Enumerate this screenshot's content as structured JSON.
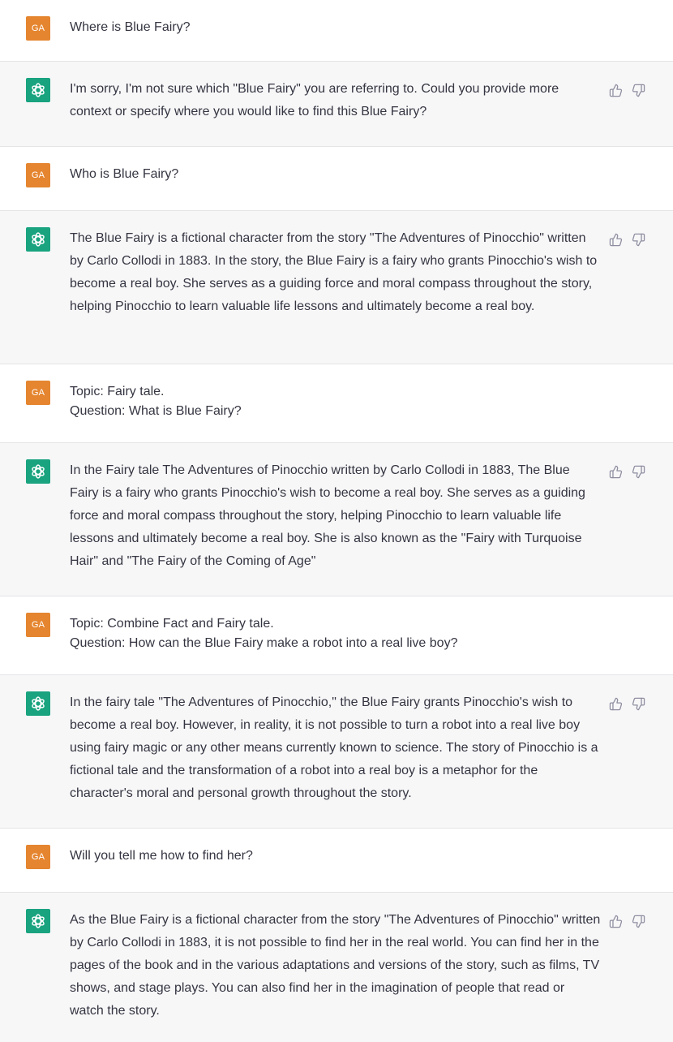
{
  "user_avatar_label": "GA",
  "messages": [
    {
      "role": "user",
      "lines": [
        "Where is Blue Fairy?"
      ]
    },
    {
      "role": "assistant",
      "text": "I'm sorry, I'm not sure which \"Blue Fairy\" you are referring to. Could you provide more context or specify where you would like to find this Blue Fairy?"
    },
    {
      "role": "user",
      "lines": [
        "Who is Blue Fairy?"
      ]
    },
    {
      "role": "assistant",
      "text": "The Blue Fairy is a fictional character from the story \"The Adventures of Pinocchio\" written by Carlo Collodi in 1883. In the story, the Blue Fairy is a fairy who grants Pinocchio's wish to become a real boy. She serves as a guiding force and moral compass throughout the story, helping Pinocchio to learn valuable life lessons and ultimately become a real boy."
    },
    {
      "role": "user",
      "lines": [
        "Topic: Fairy tale.",
        "Question: What is Blue Fairy?"
      ]
    },
    {
      "role": "assistant",
      "text": "In the Fairy tale The Adventures of Pinocchio written by Carlo Collodi in 1883, The Blue Fairy is a fairy who grants Pinocchio's wish to become a real boy. She serves as a guiding force and moral compass throughout the story, helping Pinocchio to learn valuable life lessons and ultimately become a real boy. She is also known as the \"Fairy with Turquoise Hair\" and \"The Fairy of the Coming of Age\""
    },
    {
      "role": "user",
      "lines": [
        "Topic: Combine Fact and Fairy tale.",
        "Question: How can the Blue Fairy make a robot into a real live boy?"
      ]
    },
    {
      "role": "assistant",
      "text": "In the fairy tale \"The Adventures of Pinocchio,\" the Blue Fairy grants Pinocchio's wish to become a real boy. However, in reality, it is not possible to turn a robot into a real live boy using fairy magic or any other means currently known to science. The story of Pinocchio is a fictional tale and the transformation of a robot into a real boy is a metaphor for the character's moral and personal growth throughout the story."
    },
    {
      "role": "user",
      "lines": [
        "Will you tell me how to find her?"
      ]
    },
    {
      "role": "assistant",
      "text": "As the Blue Fairy is a fictional character from the story \"The Adventures of Pinocchio\" written by Carlo Collodi in 1883, it is not possible to find her in the real world. You can find her in the pages of the book and in the various adaptations and versions of the story, such as films, TV shows, and stage plays. You can also find her in the imagination of people that read or watch the story."
    }
  ],
  "icons": {
    "assistant_avatar": "openai-logo-icon",
    "like": "thumbs-up-icon",
    "dislike": "thumbs-down-icon"
  },
  "colors": {
    "user_avatar": "#e5852f",
    "assistant_avatar": "#19a37f",
    "assistant_bg": "#f7f7f8"
  }
}
